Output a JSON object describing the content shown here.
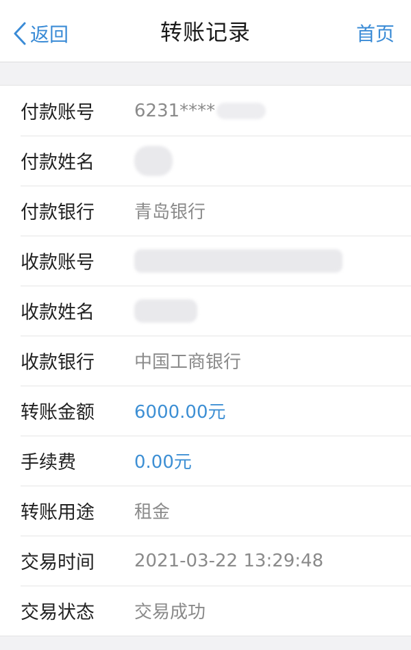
{
  "nav": {
    "back_label": "返回",
    "title": "转账记录",
    "home_label": "首页"
  },
  "colors": {
    "accent": "#3a8bd6",
    "label": "#222222",
    "value": "#8a8a8a"
  },
  "icons": {
    "back": "chevron-left-icon"
  },
  "details": {
    "payer_account": {
      "label": "付款账号",
      "value": "6231****"
    },
    "payer_name": {
      "label": "付款姓名",
      "value": ""
    },
    "payer_bank": {
      "label": "付款银行",
      "value": "青岛银行"
    },
    "payee_account": {
      "label": "收款账号",
      "value": ""
    },
    "payee_name": {
      "label": "收款姓名",
      "value": ""
    },
    "payee_bank": {
      "label": "收款银行",
      "value": "中国工商银行"
    },
    "amount": {
      "label": "转账金额",
      "value": "6000.00元"
    },
    "fee": {
      "label": "手续费",
      "value": "0.00元"
    },
    "purpose": {
      "label": "转账用途",
      "value": "租金"
    },
    "time": {
      "label": "交易时间",
      "value": "2021-03-22 13:29:48"
    },
    "status": {
      "label": "交易状态",
      "value": "交易成功"
    }
  }
}
